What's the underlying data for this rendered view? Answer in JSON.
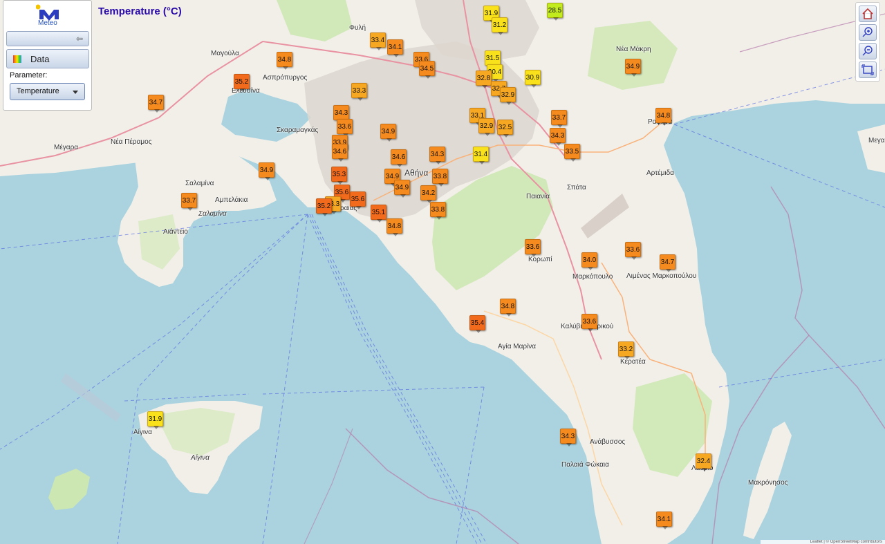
{
  "header": {
    "title": "Temperature (°C)"
  },
  "panel": {
    "logo_text": "Meteo",
    "data_button": "Data",
    "parameter_label": "Parameter:",
    "parameter_value": "Temperature"
  },
  "toolbar": {
    "icons": [
      "home-icon",
      "zoom-in-icon",
      "zoom-out-icon",
      "full-extent-icon"
    ]
  },
  "colors": {
    "sea": "#aad3df",
    "land": "#f2efe9",
    "hot": "#f47b20",
    "warm": "#f5a623",
    "mild": "#ffe600",
    "cool": "#c8ef20"
  },
  "places": {
    "fyli": "Φυλή",
    "magoula": "Μαγούλα",
    "aspropyrgos": "Ασπρόπυργος",
    "elefsina": "Ελευσίνα",
    "megara": "Μέγαρα",
    "nea_peramos": "Νέα Πέραμος",
    "skaramagkas": "Σκαραμαγκάς",
    "salamina": "Σαλαμίνα",
    "salamina_island": "Σαλαμίνα",
    "ampelakia": "Αμπελάκια",
    "aianteio": "Αιάντειο",
    "athina": "Αθήνα",
    "peiraias": "Πειραιάς",
    "nea_makri": "Νέα Μάκρη",
    "rafina": "Ραφήνα",
    "artemida": "Αρτέμιδα",
    "spata": "Σπάτα",
    "paiania": "Παιανία",
    "koropi": "Κορωπί",
    "markopoulo": "Μαρκόπουλο",
    "limenas": "Λιμένας Μαρκοπούλου",
    "kalyvia": "Καλύβια Θορικού",
    "agia_marina": "Αγία Μαρίνα",
    "keratea": "Κερατέα",
    "anavyssos": "Ανάβυσσος",
    "palaia_fokaia": "Παλαιά Φώκαια",
    "lavrio": "Λαύριο",
    "aigina_town": "Αίγινα",
    "aigina": "Αίγινα",
    "makronisos": "Μακρόνησος",
    "megal": "Μεγαλ"
  },
  "attribution": "Leaflet | © OpenStreetMap contributors",
  "stations": [
    {
      "v": "31.9"
    },
    {
      "v": "28.5"
    },
    {
      "v": "31.2"
    },
    {
      "v": "33.4"
    },
    {
      "v": "34.1"
    },
    {
      "v": "34.8"
    },
    {
      "v": "33.6"
    },
    {
      "v": "34.5"
    },
    {
      "v": "31.5"
    },
    {
      "v": "30.4"
    },
    {
      "v": "32.8"
    },
    {
      "v": "30.9"
    },
    {
      "v": "34.9"
    },
    {
      "v": "35.2"
    },
    {
      "v": "33.3"
    },
    {
      "v": "32.7"
    },
    {
      "v": "32.9"
    },
    {
      "v": "34.7"
    },
    {
      "v": "34.3"
    },
    {
      "v": "33.1"
    },
    {
      "v": "33.7"
    },
    {
      "v": "34.8"
    },
    {
      "v": "33.6"
    },
    {
      "v": "32.9"
    },
    {
      "v": "32.5"
    },
    {
      "v": "34.9"
    },
    {
      "v": "34.3"
    },
    {
      "v": "33.9"
    },
    {
      "v": "33.5"
    },
    {
      "v": "34.6"
    },
    {
      "v": "34.6"
    },
    {
      "v": "34.3"
    },
    {
      "v": "31.4"
    },
    {
      "v": "34.9"
    },
    {
      "v": "35.3"
    },
    {
      "v": "34.9"
    },
    {
      "v": "33.8"
    },
    {
      "v": "34.9"
    },
    {
      "v": "35.6"
    },
    {
      "v": "34.2"
    },
    {
      "v": "33.7"
    },
    {
      "v": "35.6"
    },
    {
      "v": "33.3"
    },
    {
      "v": "35.2"
    },
    {
      "v": "35.1"
    },
    {
      "v": "33.8"
    },
    {
      "v": "34.8"
    },
    {
      "v": "33.6"
    },
    {
      "v": "34.0"
    },
    {
      "v": "33.6"
    },
    {
      "v": "34.7"
    },
    {
      "v": "34.8"
    },
    {
      "v": "35.4"
    },
    {
      "v": "33.6"
    },
    {
      "v": "33.2"
    },
    {
      "v": "31.9"
    },
    {
      "v": "34.3"
    },
    {
      "v": "32.4"
    },
    {
      "v": "34.1"
    }
  ]
}
